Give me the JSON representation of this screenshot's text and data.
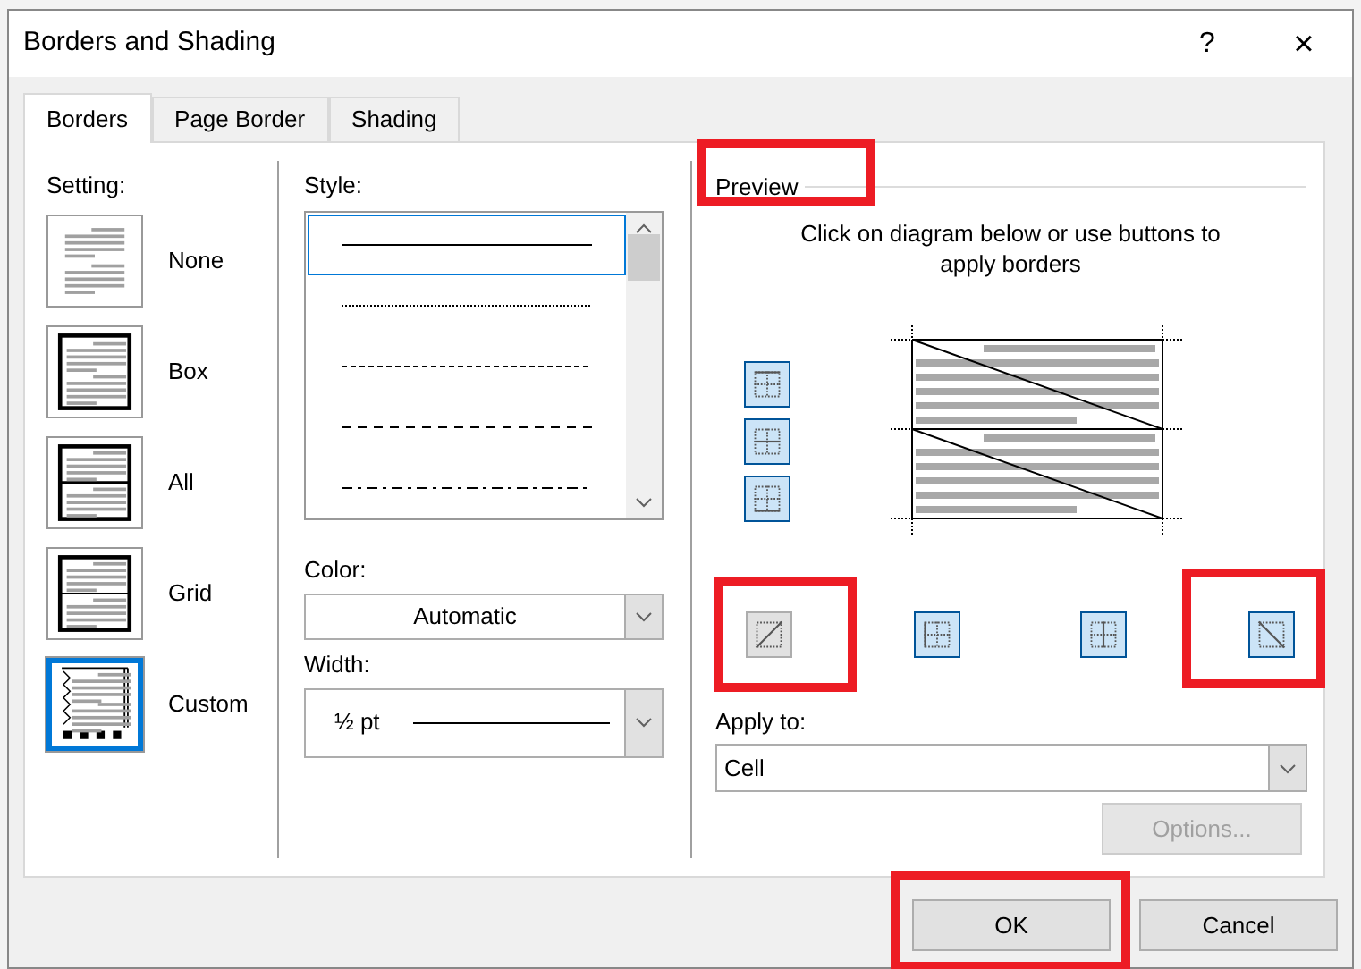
{
  "window": {
    "title": "Borders and Shading",
    "help": "?",
    "close": "×"
  },
  "tabs": [
    {
      "label": "Borders",
      "selected": true
    },
    {
      "label": "Page Border",
      "selected": false
    },
    {
      "label": "Shading",
      "selected": false
    }
  ],
  "setting": {
    "label": "Setting:",
    "options": [
      {
        "label": "None",
        "kind": "none",
        "selected": false
      },
      {
        "label": "Box",
        "kind": "box",
        "selected": false
      },
      {
        "label": "All",
        "kind": "all",
        "selected": false
      },
      {
        "label": "Grid",
        "kind": "grid",
        "selected": false
      },
      {
        "label": "Custom",
        "kind": "custom",
        "selected": true
      }
    ]
  },
  "style": {
    "label": "Style:",
    "options": [
      {
        "kind": "solid",
        "selected": true
      },
      {
        "kind": "dotted",
        "selected": false
      },
      {
        "kind": "dashed",
        "selected": false
      },
      {
        "kind": "long-dashed",
        "selected": false
      },
      {
        "kind": "dash-dot",
        "selected": false
      }
    ]
  },
  "color": {
    "label": "Color:",
    "value": "Automatic"
  },
  "width": {
    "label": "Width:",
    "value": "½ pt"
  },
  "preview": {
    "title": "Preview",
    "instructions": "Click on diagram below or use buttons to apply borders",
    "side_buttons": [
      {
        "kind": "top",
        "selected": true
      },
      {
        "kind": "inside-horizontal",
        "selected": true
      },
      {
        "kind": "bottom",
        "selected": true
      }
    ],
    "bottom_buttons": [
      {
        "kind": "diagonal-up",
        "selected": false
      },
      {
        "kind": "left",
        "selected": true
      },
      {
        "kind": "inside-vertical",
        "selected": true
      },
      {
        "kind": "diagonal-down",
        "selected": true
      }
    ]
  },
  "apply_to": {
    "label": "Apply to:",
    "value": "Cell"
  },
  "options_button": {
    "label": "Options...",
    "disabled": true
  },
  "buttons": [
    "OK",
    "Cancel"
  ]
}
